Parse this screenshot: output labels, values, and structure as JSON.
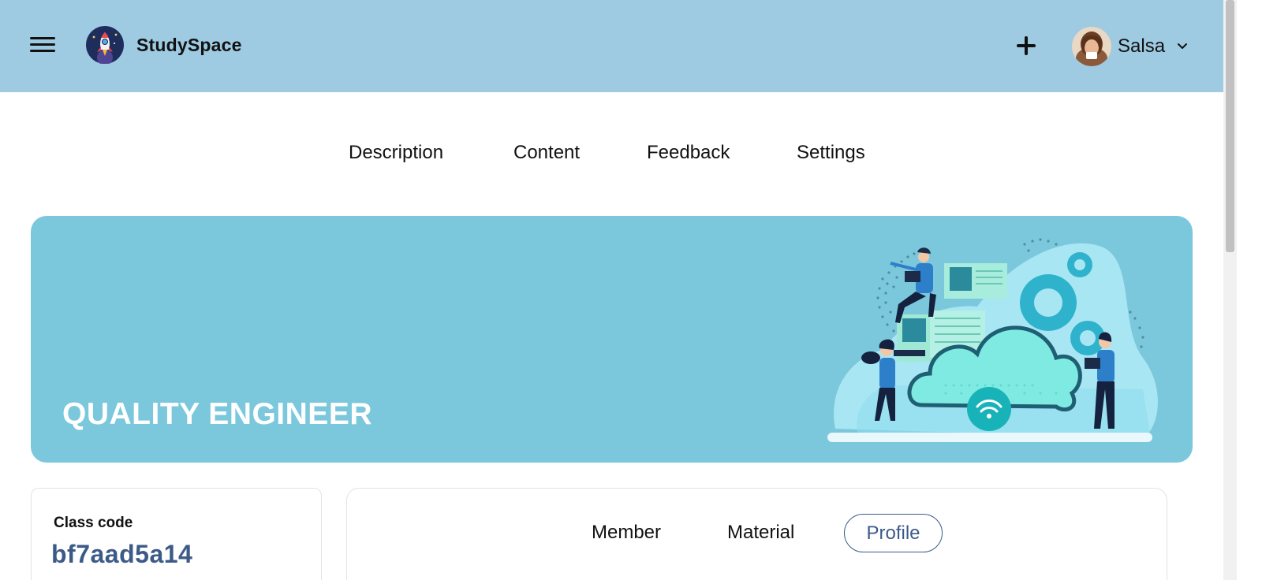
{
  "header": {
    "brand": "StudySpace",
    "user_name": "Salsa",
    "colors": {
      "bar": "#9ecae2"
    }
  },
  "tabs": [
    {
      "label": "Description"
    },
    {
      "label": "Content"
    },
    {
      "label": "Feedback"
    },
    {
      "label": "Settings"
    }
  ],
  "banner": {
    "title": "QUALITY ENGINEER",
    "color": "#7bc8dc"
  },
  "class_info": {
    "label": "Class code",
    "code": "bf7aad5a14"
  },
  "subtabs": {
    "items": [
      {
        "label": "Member"
      },
      {
        "label": "Material"
      }
    ],
    "active": "Profile",
    "accent": "#3c5a88"
  },
  "icons": {
    "menu": "hamburger-menu-icon",
    "logo": "rocket-logo-icon",
    "add": "plus-icon",
    "dropdown": "chevron-down-icon"
  }
}
